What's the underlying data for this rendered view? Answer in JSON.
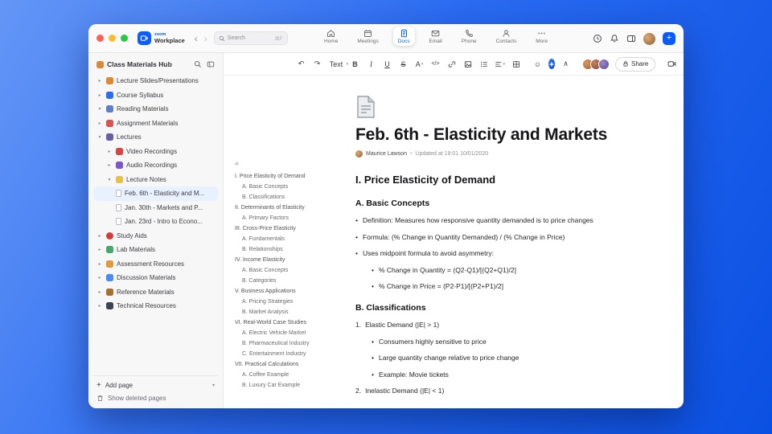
{
  "titlebar": {
    "brand_top": "zoom",
    "brand_bottom": "Workplace",
    "back_arrow": "‹",
    "forward_arrow": "›",
    "search_placeholder": "Search",
    "search_shortcut": "⌘F"
  },
  "nav": {
    "tabs": [
      {
        "label": "Home",
        "icon": "home-icon"
      },
      {
        "label": "Meetings",
        "icon": "calendar-icon"
      },
      {
        "label": "Docs",
        "icon": "doc-icon",
        "active": true
      },
      {
        "label": "Email",
        "icon": "mail-icon"
      },
      {
        "label": "Phone",
        "icon": "phone-icon"
      },
      {
        "label": "Contacts",
        "icon": "contacts-icon"
      },
      {
        "label": "More",
        "icon": "more-icon"
      }
    ]
  },
  "sidebar": {
    "title": "Class Materials Hub",
    "items": [
      {
        "label": "Lecture Slides/Presentations",
        "icon": "presentation-icon",
        "chevron": "▸",
        "depth": 0
      },
      {
        "label": "Course Syllabus",
        "icon": "book-icon",
        "chevron": "▸",
        "depth": 0
      },
      {
        "label": "Reading Materials",
        "icon": "open-book-icon",
        "chevron": "▾",
        "depth": 0
      },
      {
        "label": "Assignment Materials",
        "icon": "assignment-icon",
        "chevron": "▸",
        "depth": 0
      },
      {
        "label": "Lectures",
        "icon": "lectures-icon",
        "chevron": "▾",
        "depth": 0
      },
      {
        "label": "Video Recordings",
        "icon": "video-icon",
        "chevron": "▸",
        "depth": 1
      },
      {
        "label": "Audio Recordings",
        "icon": "audio-icon",
        "chevron": "▸",
        "depth": 1
      },
      {
        "label": "Lecture Notes",
        "icon": "notes-icon",
        "chevron": "▾",
        "depth": 1
      },
      {
        "label": "Feb. 6th - Elasticity and M...",
        "icon": "page-icon",
        "chevron": "",
        "depth": 2,
        "selected": true
      },
      {
        "label": "Jan. 30th - Markets and P...",
        "icon": "page-icon",
        "chevron": "",
        "depth": 2
      },
      {
        "label": "Jan. 23rd - Intro to Econo...",
        "icon": "page-icon",
        "chevron": "",
        "depth": 2
      },
      {
        "label": "Study Aids",
        "icon": "apple-icon",
        "chevron": "▸",
        "depth": 0
      },
      {
        "label": "Lab Materials",
        "icon": "lab-icon",
        "chevron": "▸",
        "depth": 0
      },
      {
        "label": "Assessment Resources",
        "icon": "assessment-icon",
        "chevron": "▸",
        "depth": 0
      },
      {
        "label": "Discussion Materials",
        "icon": "discussion-icon",
        "chevron": "▸",
        "depth": 0
      },
      {
        "label": "Reference Materials",
        "icon": "reference-icon",
        "chevron": "▸",
        "depth": 0
      },
      {
        "label": "Technical Resources",
        "icon": "technical-icon",
        "chevron": "▸",
        "depth": 0
      }
    ],
    "add_page": "Add page",
    "show_deleted": "Show deleted pages"
  },
  "toolbar": {
    "undo": "↶",
    "redo": "↷",
    "text_style": "Text",
    "bold": "B",
    "italic": "I",
    "underline": "U",
    "strikethrough": "S",
    "text_color": "A",
    "code": "</>",
    "emoji": "☺",
    "collapse": "∧",
    "share": "Share",
    "more": "⋯"
  },
  "toc": {
    "collapse_glyph": "«",
    "items": [
      {
        "label": "I. Price Elasticity of Demand",
        "level": 0
      },
      {
        "label": "A. Basic Concepts",
        "level": 1
      },
      {
        "label": "B. Classifications",
        "level": 1
      },
      {
        "label": "II. Determinants of Elasticity",
        "level": 0
      },
      {
        "label": "A. Primary Factors",
        "level": 1
      },
      {
        "label": "III. Cross-Price Elasticity",
        "level": 0
      },
      {
        "label": "A. Fundamentals",
        "level": 1
      },
      {
        "label": "B. Relationships",
        "level": 1
      },
      {
        "label": "IV. Income Elasticity",
        "level": 0
      },
      {
        "label": "A. Basic Concepts",
        "level": 1
      },
      {
        "label": "B. Categories",
        "level": 1
      },
      {
        "label": "V. Business Applications",
        "level": 0
      },
      {
        "label": "A. Pricing Strategies",
        "level": 1
      },
      {
        "label": "B. Market Analysis",
        "level": 1
      },
      {
        "label": "VI. Real-World Case Studies",
        "level": 0
      },
      {
        "label": "A. Electric Vehicle Market",
        "level": 1
      },
      {
        "label": "B. Pharmaceutical Industry",
        "level": 1
      },
      {
        "label": "C. Entertainment Industry",
        "level": 1
      },
      {
        "label": "VII. Practical Calculations",
        "level": 0
      },
      {
        "label": "A. Coffee Example",
        "level": 1
      },
      {
        "label": "B. Luxury Car Example",
        "level": 1
      }
    ]
  },
  "doc": {
    "title": "Feb. 6th - Elasticity and Markets",
    "author": "Maurice Lawson",
    "byline_sep": "•",
    "updated": "Updated at 19:01 10/01/2020",
    "section1_heading": "I. Price Elasticity of Demand",
    "section1a_heading": "A. Basic Concepts",
    "bullets": [
      "Definition: Measures how responsive quantity demanded is to price changes",
      "Formula: (% Change in Quantity Demanded) / (% Change in Price)",
      "Uses midpoint formula to avoid asymmetry:"
    ],
    "sub_bullets": [
      "% Change in Quantity = (Q2-Q1)/[(Q2+Q1)/2]",
      "% Change in Price = (P2-P1)/[(P2+P1)/2]"
    ],
    "section1b_heading": "B. Classifications",
    "numbered": [
      {
        "num": "1.",
        "text": "Elastic Demand (|E| > 1)"
      },
      {
        "num": "2.",
        "text": "Inelastic Demand (|E| < 1)"
      }
    ],
    "elastic_bullets": [
      "Consumers highly sensitive to price",
      "Large quantity change relative to price change",
      "Example: Movie tickets"
    ]
  },
  "colors": {
    "accent": "#0b5cff",
    "desktop_gradient_start": "#6496f6",
    "desktop_gradient_end": "#0a50e2"
  }
}
